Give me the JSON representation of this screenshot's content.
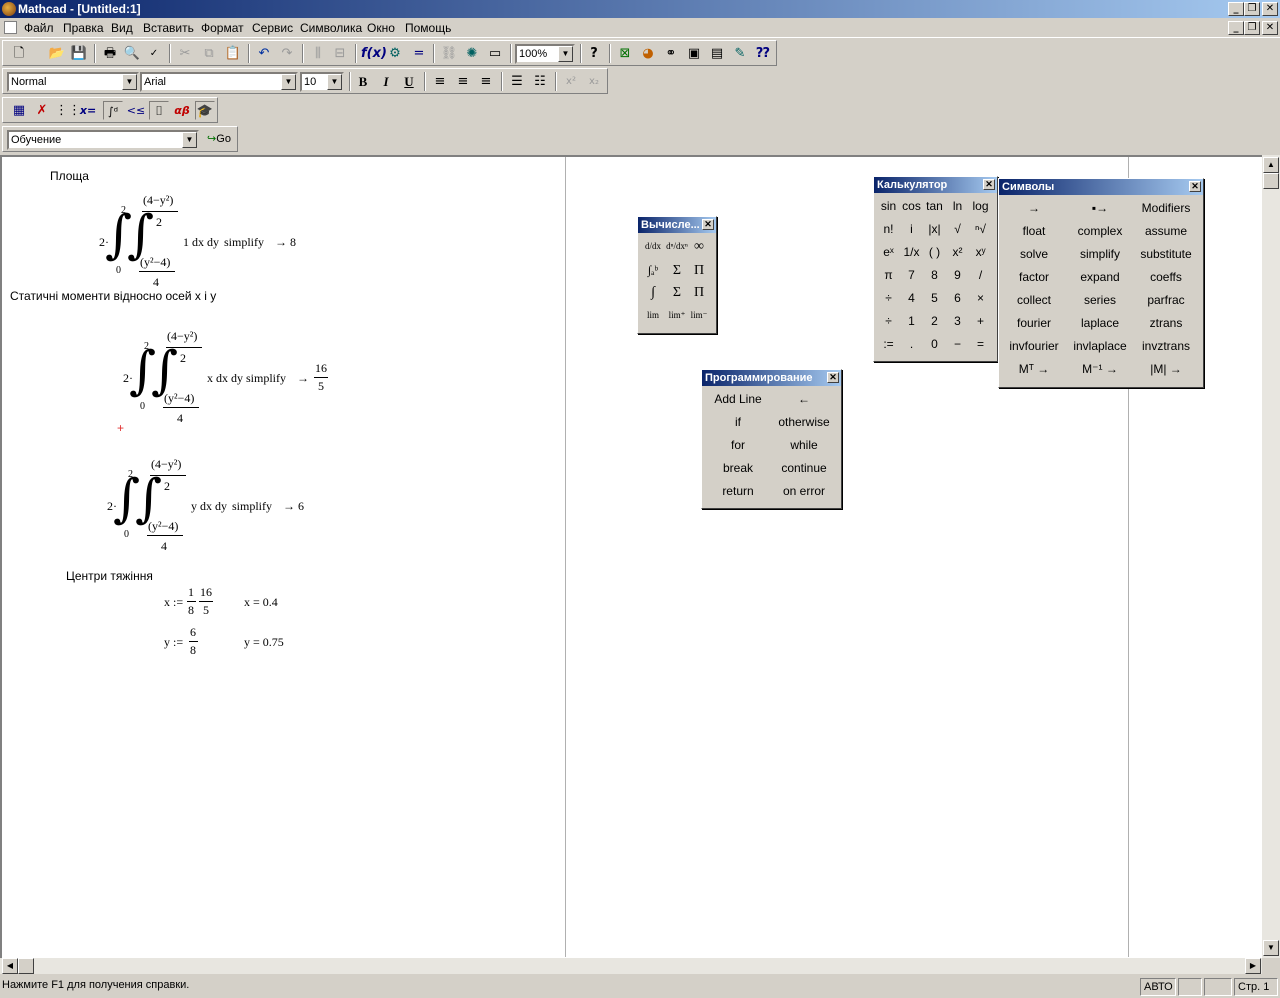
{
  "window": {
    "title": "Mathcad - [Untitled:1]"
  },
  "menu": [
    "Файл",
    "Правка",
    "Вид",
    "Вставить",
    "Формат",
    "Сервис",
    "Символика",
    "Окно",
    "Помощь"
  ],
  "toolbar": {
    "zoom": "100%"
  },
  "format_bar": {
    "style": "Normal",
    "font": "Arial",
    "size": "10",
    "bold": "B",
    "italic": "I",
    "underline": "U"
  },
  "tutorial_bar": {
    "value": "Обучение",
    "go": "Go"
  },
  "doc": {
    "heading_area": "Площа",
    "area_expr": {
      "coef": "2·",
      "upper_num": "(4−y²)",
      "upper_den": "2",
      "lower_num": "(y²−4)",
      "lower_den": "4",
      "lim_low": "0",
      "lim_high": "2",
      "integrand": "1 dx dy",
      "kw": "simplify",
      "result": "→ 8"
    },
    "heading_moments": "Статичні моменти відносно осей x і y",
    "mx_expr": {
      "coef": "2·",
      "upper_num": "(4−y²)",
      "upper_den": "2",
      "lower_num": "(y²−4)",
      "lower_den": "4",
      "lim_low": "0",
      "lim_high": "2",
      "integrand": "x dx dy",
      "kw": "simplify",
      "arrow": "→",
      "res_num": "16",
      "res_den": "5"
    },
    "my_expr": {
      "coef": "2·",
      "upper_num": "(4−y²)",
      "upper_den": "2",
      "lower_num": "(y²−4)",
      "lower_den": "4",
      "lim_low": "0",
      "lim_high": "2",
      "integrand": "y dx dy",
      "kw": "simplify",
      "result": "→ 6"
    },
    "heading_centers": "Центри тяжіння",
    "x_def": {
      "lhs": "x :=",
      "n1": "1",
      "d1": "8",
      "n2": "16",
      "d2": "5",
      "eval": "x = 0.4"
    },
    "y_def": {
      "lhs": "y :=",
      "n1": "6",
      "d1": "8",
      "eval": "y = 0.75"
    }
  },
  "calculus_palette": {
    "title": "Вычисле...",
    "buttons": [
      "d/dx",
      "dⁿ/dxⁿ",
      "∞",
      "∫ₐᵇ",
      "Σ",
      "Π",
      "∫",
      "Σ",
      "Π",
      "lim",
      "lim⁺",
      "lim⁻"
    ]
  },
  "calculator_palette": {
    "title": "Калькулятор",
    "buttons": [
      "sin",
      "cos",
      "tan",
      "ln",
      "log",
      "n!",
      "i",
      "|x|",
      "√",
      "ⁿ√",
      "eˣ",
      "1/x",
      "( )",
      "x²",
      "xʸ",
      "π",
      "7",
      "8",
      "9",
      "/",
      "÷",
      "4",
      "5",
      "6",
      "×",
      "÷",
      "1",
      "2",
      "3",
      "+",
      ":=",
      ".",
      "0",
      "−",
      "="
    ]
  },
  "symbolic_palette": {
    "title": "Символы",
    "buttons": [
      "→",
      "▪→",
      "Modifiers",
      "float",
      "complex",
      "assume",
      "solve",
      "simplify",
      "substitute",
      "factor",
      "expand",
      "coeffs",
      "collect",
      "series",
      "parfrac",
      "fourier",
      "laplace",
      "ztrans",
      "invfourier",
      "invlaplace",
      "invztrans",
      "Mᵀ →",
      "M⁻¹ →",
      "|M| →"
    ]
  },
  "programming_palette": {
    "title": "Программирование",
    "buttons": [
      "Add Line",
      "←",
      "if",
      "otherwise",
      "for",
      "while",
      "break",
      "continue",
      "return",
      "on error"
    ]
  },
  "status": {
    "help": "Нажмите F1 для получения справки.",
    "mode": "АВТО",
    "page": "Стр. 1"
  }
}
